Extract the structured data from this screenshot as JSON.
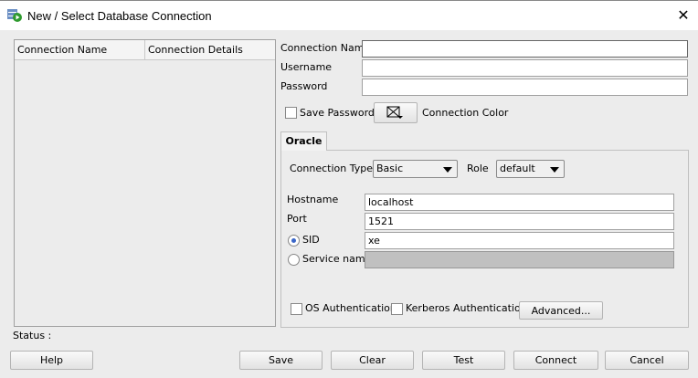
{
  "window": {
    "title": "New / Select Database Connection",
    "close": "✕"
  },
  "list": {
    "columns": [
      "Connection Name",
      "Connection Details"
    ]
  },
  "form": {
    "connection_name": {
      "label": "Connection Name",
      "mnemonic": 11,
      "value": ""
    },
    "username": {
      "label": "Username",
      "mnemonic": 0,
      "value": ""
    },
    "password": {
      "label": "Password",
      "mnemonic": 0,
      "value": ""
    },
    "save_password": {
      "label": "Save Password",
      "mnemonic": 2,
      "checked": false
    },
    "connection_color_label": "Connection Color"
  },
  "tab": {
    "label": "Oracle"
  },
  "oracle": {
    "connection_type": {
      "label": "Connection Type",
      "mnemonic": 13,
      "value": "Basic"
    },
    "role": {
      "label": "Role",
      "mnemonic": 2,
      "value": "default"
    },
    "hostname": {
      "label": "Hostname",
      "mnemonic": 4,
      "value": "localhost"
    },
    "port": {
      "label": "Port",
      "mnemonic": 2,
      "value": "1521"
    },
    "sid": {
      "label": "SID",
      "mnemonic": 1,
      "value": "xe",
      "selected": true
    },
    "service_name": {
      "label": "Service name",
      "mnemonic": 1,
      "value": "",
      "selected": false
    },
    "os_auth": {
      "label": "OS Authentication",
      "checked": false
    },
    "kerberos_auth": {
      "label": "Kerberos Authentication",
      "checked": false
    },
    "advanced": "Advanced..."
  },
  "status": {
    "label": "Status :"
  },
  "buttons": {
    "help": {
      "label": "Help",
      "mnemonic": 0
    },
    "save": {
      "label": "Save",
      "mnemonic": 0
    },
    "clear": {
      "label": "Clear",
      "mnemonic": 1
    },
    "test": {
      "label": "Test",
      "mnemonic": 0
    },
    "connect": {
      "label": "Connect",
      "mnemonic": 1
    },
    "cancel": {
      "label": "Cancel"
    }
  }
}
